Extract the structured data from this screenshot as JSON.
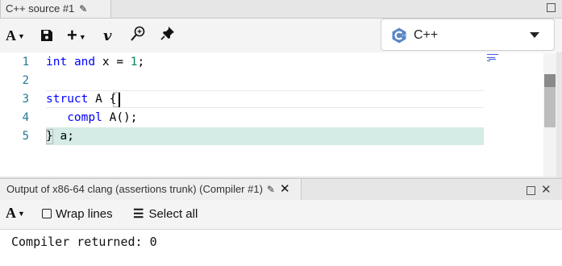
{
  "source_tab": {
    "label": "C++ source #1",
    "edit_icon": "pencil-icon"
  },
  "toolbar": {
    "font_label": "A",
    "buttons": [
      "save-icon",
      "add-icon",
      "vim-icon",
      "search-icon",
      "pin-icon"
    ],
    "vim_label": "v",
    "add_label": "+"
  },
  "language": {
    "label": "C++",
    "logo": "cpp-logo-icon",
    "accent": "#5b86c6"
  },
  "editor": {
    "line_numbers": [
      "1",
      "2",
      "3",
      "4",
      "5"
    ],
    "lines": [
      [
        {
          "t": "int",
          "c": "kw"
        },
        {
          "t": " "
        },
        {
          "t": "and",
          "c": "kw"
        },
        {
          "t": " x = "
        },
        {
          "t": "1",
          "c": "num"
        },
        {
          "t": ";"
        }
      ],
      [],
      [
        {
          "t": "struct",
          "c": "kw"
        },
        {
          "t": " A {"
        }
      ],
      [
        {
          "t": "   "
        },
        {
          "t": "compl",
          "c": "kw"
        },
        {
          "t": " A();"
        }
      ],
      [
        {
          "t": "} a;"
        }
      ]
    ]
  },
  "output_tab": {
    "label": "Output of x86-64 clang (assertions trunk) (Compiler #1)"
  },
  "output_toolbar": {
    "font_label": "A",
    "wrap_label": "Wrap lines",
    "select_all_label": "Select all"
  },
  "output": {
    "text": "Compiler returned: 0"
  }
}
